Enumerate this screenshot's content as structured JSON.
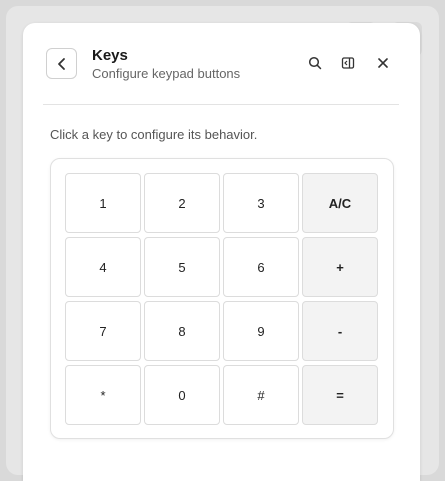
{
  "header": {
    "title": "Keys",
    "subtitle": "Configure keypad buttons",
    "icons": [
      "back-chevron-icon",
      "search-icon",
      "panel-toggle-icon",
      "close-icon"
    ]
  },
  "instruction": "Click a key to configure its behavior.",
  "keypad": {
    "keys": [
      {
        "label": "1",
        "type": "digit"
      },
      {
        "label": "2",
        "type": "digit"
      },
      {
        "label": "3",
        "type": "digit"
      },
      {
        "label": "A/C",
        "type": "op"
      },
      {
        "label": "4",
        "type": "digit"
      },
      {
        "label": "5",
        "type": "digit"
      },
      {
        "label": "6",
        "type": "digit"
      },
      {
        "label": "+",
        "type": "op"
      },
      {
        "label": "7",
        "type": "digit"
      },
      {
        "label": "8",
        "type": "digit"
      },
      {
        "label": "9",
        "type": "digit"
      },
      {
        "label": "-",
        "type": "op"
      },
      {
        "label": "*",
        "type": "digit"
      },
      {
        "label": "0",
        "type": "digit"
      },
      {
        "label": "#",
        "type": "digit"
      },
      {
        "label": "=",
        "type": "op"
      }
    ]
  },
  "colors": {
    "operator_key_bg": "#f3f3f3",
    "key_bg": "#ffffff",
    "panel_bg": "#ffffff"
  }
}
